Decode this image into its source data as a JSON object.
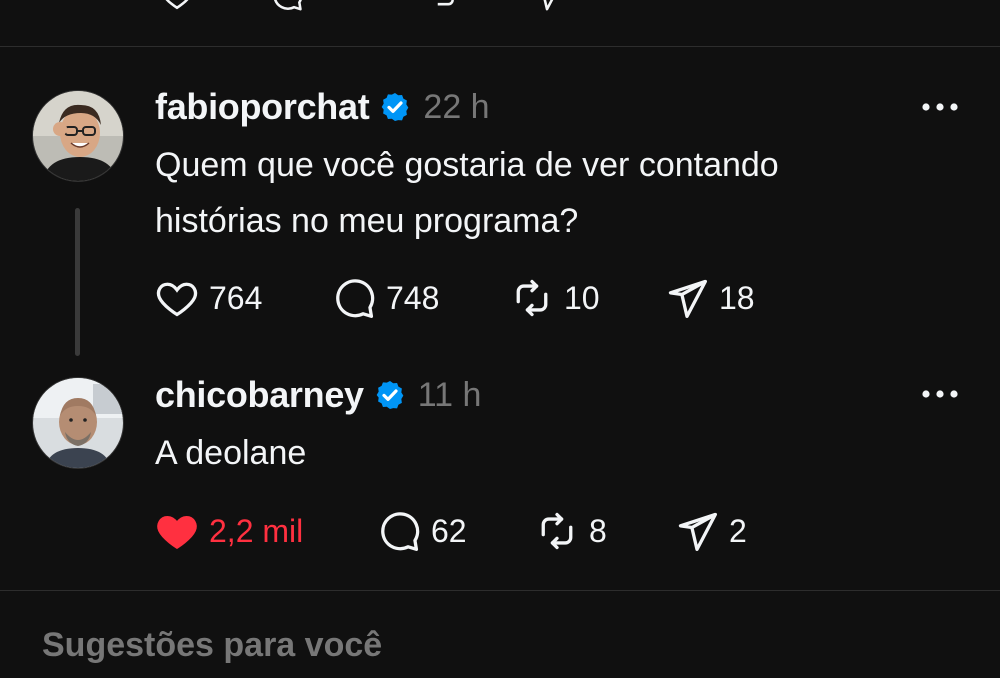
{
  "colors": {
    "background": "#101010",
    "text": "#f3f5f7",
    "muted": "#777777",
    "divider": "#2d2d2d",
    "verified": "#0095f6",
    "like_active": "#ff3040"
  },
  "posts": [
    {
      "username": "fabioporchat",
      "verified": true,
      "time": "22 h",
      "text_line1": "Quem que você gostaria de ver contando",
      "text_line2": "histórias no meu programa?",
      "likes": "764",
      "comments": "748",
      "reposts": "10",
      "shares": "18",
      "liked": false
    },
    {
      "username": "chicobarney",
      "verified": true,
      "time": "11 h",
      "text_line1": "A deolane",
      "likes": "2,2 mil",
      "comments": "62",
      "reposts": "8",
      "shares": "2",
      "liked": true
    }
  ],
  "suggestions": {
    "title": "Sugestões para você"
  }
}
